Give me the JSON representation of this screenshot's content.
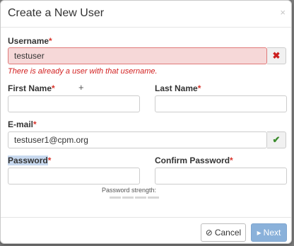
{
  "modal": {
    "title": "Create a New User",
    "close_glyph": "×"
  },
  "required_mark": "*",
  "username": {
    "label": "Username",
    "value": "testuser",
    "error_icon": "✖",
    "error_message": "There is already a user with that username."
  },
  "first_name": {
    "label": "First Name",
    "value": "",
    "cursor_glyph": "+"
  },
  "last_name": {
    "label": "Last Name",
    "value": ""
  },
  "email": {
    "label": "E-mail",
    "value": "testuser1@cpm.org",
    "ok_icon": "✔"
  },
  "password": {
    "label": "Password",
    "value": "",
    "strength_label": "Password strength:",
    "strength_level": 0
  },
  "confirm_password": {
    "label": "Confirm Password",
    "value": ""
  },
  "footer": {
    "cancel_label": "Cancel",
    "cancel_icon": "⊘",
    "next_label": "Next",
    "next_icon": "▸"
  },
  "colors": {
    "required": "#d9342b",
    "error_bg": "#f6d8d8",
    "error_text": "#d21f1f",
    "ok_icon": "#3a8b2c",
    "next_button": "#8ab1da"
  }
}
